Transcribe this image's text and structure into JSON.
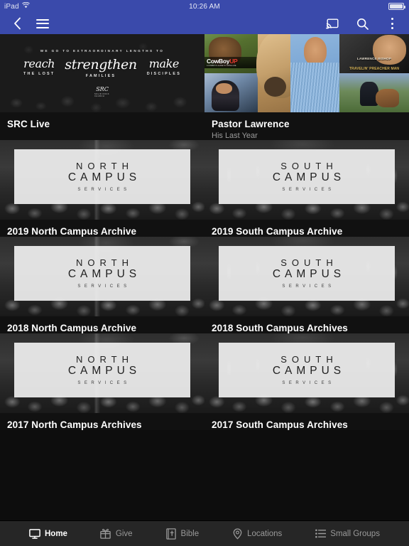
{
  "status_bar": {
    "device": "iPad",
    "wifi_icon": "wifi-icon",
    "time": "10:26 AM",
    "battery_icon": "battery-full-icon"
  },
  "app_bar": {
    "background_color": "#3a4aab",
    "back_icon": "back-chevron-icon",
    "menu_icon": "hamburger-menu-icon",
    "cast_icon": "chromecast-icon",
    "search_icon": "search-icon",
    "overflow_icon": "overflow-menu-icon"
  },
  "content": {
    "background_color": "#0d0d0d",
    "cards": [
      {
        "title": "SRC Live",
        "subtitle": "",
        "thumb_kind": "src-live-banner",
        "banner_text": {
          "eyebrow": "WE GO TO EXTRAORDINARY LENGTHS TO",
          "word1_script": "reach",
          "word1_sub": "THE LOST",
          "word2_script": "strengthen",
          "word2_sub": "FAMILIES",
          "word3_script": "make",
          "word3_sub": "DISCIPLES",
          "logo_mark": "SRC",
          "logo_sub": "SOLID ROCK CHURCH"
        }
      },
      {
        "title": "Pastor Lawrence",
        "subtitle": "His Last Year",
        "thumb_kind": "pastor-collage",
        "collage_text": {
          "cowboy_main": "CowBoy",
          "cowboy_accent": "UP",
          "cowboy_caption": "A COWBOY'S GUIDE TO LIVING LIFE",
          "poster_name": "LAWRENCE BISHOP",
          "poster_title": "TRAVELIN' PREACHER MAN"
        }
      },
      {
        "title": "2019 North Campus Archive",
        "subtitle": "",
        "thumb_kind": "campus-north",
        "banner_text": {
          "line1": "NORTH",
          "line2": "CAMPUS",
          "line3": "SERVICES"
        }
      },
      {
        "title": "2019 South Campus Archive",
        "subtitle": "",
        "thumb_kind": "campus-south",
        "banner_text": {
          "line1": "SOUTH",
          "line2": "CAMPUS",
          "line3": "SERVICES"
        }
      },
      {
        "title": "2018 North Campus Archive",
        "subtitle": "",
        "thumb_kind": "campus-north",
        "banner_text": {
          "line1": "NORTH",
          "line2": "CAMPUS",
          "line3": "SERVICES"
        }
      },
      {
        "title": "2018 South Campus Archives",
        "subtitle": "",
        "thumb_kind": "campus-south",
        "banner_text": {
          "line1": "SOUTH",
          "line2": "CAMPUS",
          "line3": "SERVICES"
        }
      },
      {
        "title": "2017 North Campus Archives",
        "subtitle": "",
        "thumb_kind": "campus-north",
        "banner_text": {
          "line1": "NORTH",
          "line2": "CAMPUS",
          "line3": "SERVICES"
        }
      },
      {
        "title": "2017 South Campus Archives",
        "subtitle": "",
        "thumb_kind": "campus-south",
        "banner_text": {
          "line1": "SOUTH",
          "line2": "CAMPUS",
          "line3": "SERVICES"
        }
      }
    ]
  },
  "bottom_nav": {
    "background_color": "#262626",
    "active_color": "#ffffff",
    "inactive_color": "#9a9a9a",
    "items": [
      {
        "label": "Home",
        "icon": "monitor-icon",
        "active": true
      },
      {
        "label": "Give",
        "icon": "gift-icon",
        "active": false
      },
      {
        "label": "Bible",
        "icon": "bible-book-icon",
        "active": false
      },
      {
        "label": "Locations",
        "icon": "map-pin-icon",
        "active": false
      },
      {
        "label": "Small Groups",
        "icon": "list-icon",
        "active": false
      }
    ]
  }
}
